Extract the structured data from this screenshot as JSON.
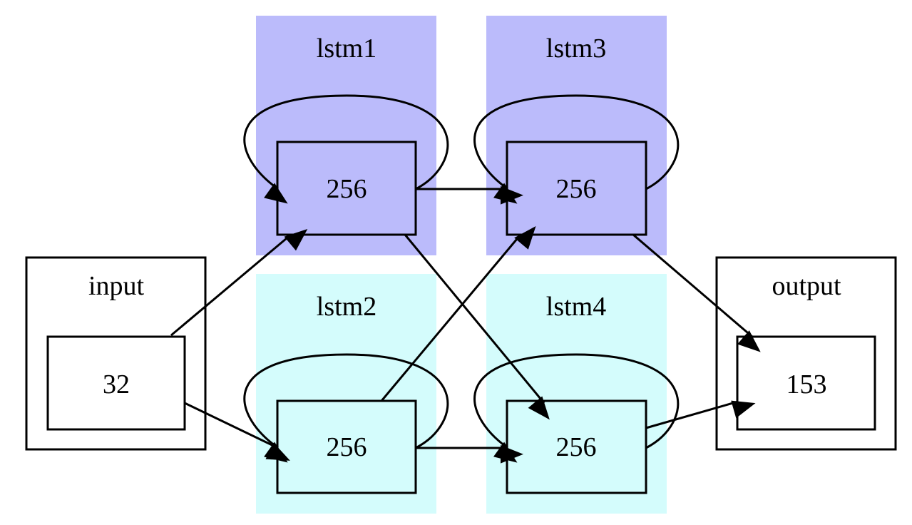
{
  "colors": {
    "lstm_top": "#bbbbfb",
    "lstm_bottom": "#d4fcfc",
    "io": "#ffffff"
  },
  "clusters": {
    "input": {
      "label": "input",
      "node": "32"
    },
    "lstm1": {
      "label": "lstm1",
      "node": "256"
    },
    "lstm2": {
      "label": "lstm2",
      "node": "256"
    },
    "lstm3": {
      "label": "lstm3",
      "node": "256"
    },
    "lstm4": {
      "label": "lstm4",
      "node": "256"
    },
    "output": {
      "label": "output",
      "node": "153"
    }
  },
  "edges": [
    [
      "input",
      "lstm1"
    ],
    [
      "input",
      "lstm2"
    ],
    [
      "lstm1",
      "lstm1"
    ],
    [
      "lstm1",
      "lstm3"
    ],
    [
      "lstm1",
      "lstm4"
    ],
    [
      "lstm2",
      "lstm2"
    ],
    [
      "lstm2",
      "lstm3"
    ],
    [
      "lstm2",
      "lstm4"
    ],
    [
      "lstm3",
      "lstm3"
    ],
    [
      "lstm3",
      "output"
    ],
    [
      "lstm4",
      "lstm4"
    ],
    [
      "lstm4",
      "output"
    ]
  ]
}
